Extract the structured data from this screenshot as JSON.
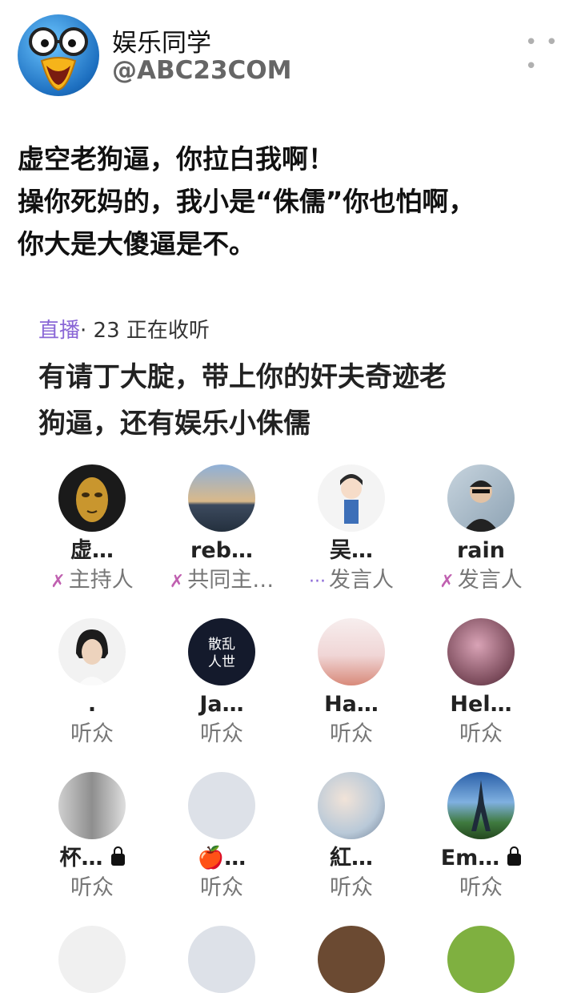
{
  "author": {
    "name": "娱乐同学",
    "handle": "@ABC23COM"
  },
  "more_icon": "more-options-icon",
  "tweet": {
    "lines": [
      "虚空老狗逼，你拉白我啊！",
      "操你死妈的，我小是“侏儒”你也怕啊，",
      "你大是大傻逼是不。"
    ]
  },
  "room": {
    "live_label": "直播",
    "listeners": "· 23 正在收听",
    "title_lines": [
      "有请丁大腚，带上你的奸夫奇迹老",
      "狗逼，还有娱乐小侏儒"
    ],
    "participants": [
      {
        "name": "虚…",
        "role": "主持人",
        "mark": "host"
      },
      {
        "name": "reb…",
        "role": "共同主…",
        "mark": "host"
      },
      {
        "name": "吴…",
        "role": "发言人",
        "mark": "dots"
      },
      {
        "name": "rain",
        "role": "发言人",
        "mark": "host"
      },
      {
        "name": ".",
        "role": "听众",
        "mark": ""
      },
      {
        "name": "Ja…",
        "role": "听众",
        "mark": ""
      },
      {
        "name": "Ha…",
        "role": "听众",
        "mark": ""
      },
      {
        "name": "Hel…",
        "role": "听众",
        "mark": ""
      },
      {
        "name": "杯…",
        "role": "听众",
        "mark": "",
        "locked": true
      },
      {
        "name": "🍎…",
        "role": "听众",
        "mark": ""
      },
      {
        "name": "紅…",
        "role": "听众",
        "mark": ""
      },
      {
        "name": "Em…",
        "role": "听众",
        "mark": "",
        "locked": true
      }
    ]
  },
  "colors": {
    "accent_purple": "#8a67d6",
    "host_pink": "#c060b0",
    "secondary_text": "#777777"
  }
}
